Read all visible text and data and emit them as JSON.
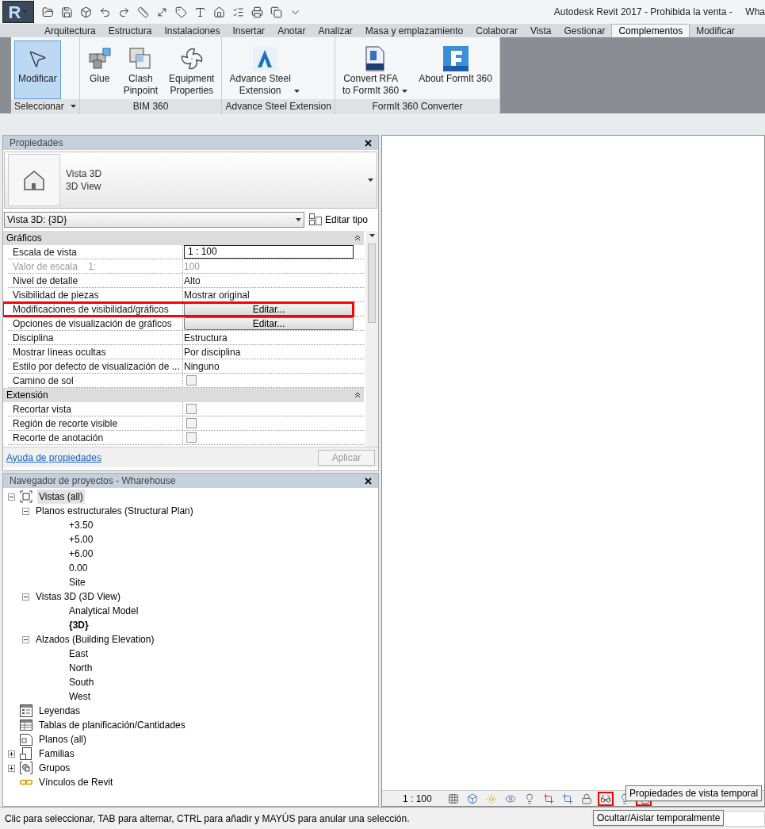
{
  "app_button": {
    "label": "R"
  },
  "window": {
    "title": "Autodesk Revit 2017 - Prohibida la venta -     Wha"
  },
  "ribbon_tabs": [
    {
      "label": "Arquitectura",
      "selected": false
    },
    {
      "label": "Estructura",
      "selected": false
    },
    {
      "label": "Instalaciones",
      "selected": false
    },
    {
      "label": "Insertar",
      "selected": false
    },
    {
      "label": "Anotar",
      "selected": false
    },
    {
      "label": "Analizar",
      "selected": false
    },
    {
      "label": "Masa y emplazamiento",
      "selected": false
    },
    {
      "label": "Colaborar",
      "selected": false
    },
    {
      "label": "Vista",
      "selected": false
    },
    {
      "label": "Gestionar",
      "selected": false
    },
    {
      "label": "Complementos",
      "selected": true
    },
    {
      "label": "Modificar",
      "selected": false
    }
  ],
  "ribbon_panels": [
    {
      "title": "Seleccionar",
      "title_menu": true,
      "buttons": [
        {
          "label_lines": [
            "Modificar"
          ],
          "selected": true,
          "dropdown": false
        }
      ]
    },
    {
      "title": "BIM 360",
      "title_menu": false,
      "buttons": [
        {
          "label_lines": [
            "Glue"
          ],
          "selected": false,
          "dropdown": false
        },
        {
          "label_lines": [
            "Clash",
            "Pinpoint"
          ],
          "selected": false,
          "dropdown": false
        },
        {
          "label_lines": [
            "Equipment",
            "Properties"
          ],
          "selected": false,
          "dropdown": false
        }
      ]
    },
    {
      "title": "Advance Steel Extension",
      "title_menu": false,
      "buttons": [
        {
          "label_lines": [
            "Advance Steel",
            "Extension"
          ],
          "selected": false,
          "dropdown": true
        }
      ]
    },
    {
      "title": "FormIt 360 Converter",
      "title_menu": false,
      "buttons": [
        {
          "label_lines": [
            "Convert RFA",
            "to FormIt 360"
          ],
          "selected": false,
          "dropdown": true
        },
        {
          "label_lines": [
            "About FormIt 360"
          ],
          "selected": false,
          "dropdown": false
        }
      ]
    }
  ],
  "properties": {
    "title": "Propiedades",
    "type_name": "Vista 3D",
    "type_subname": "3D View",
    "selector": "Vista 3D: {3D}",
    "edit_type": "Editar tipo",
    "groups": [
      {
        "title": "Gráficos",
        "rows": [
          {
            "kind": "field",
            "label": "Escala de vista",
            "value": "1 : 100",
            "disabled": false,
            "highlighted": false
          },
          {
            "kind": "value",
            "label": "Valor de escala    1:",
            "value": "100",
            "disabled": true,
            "highlighted": false
          },
          {
            "kind": "value",
            "label": "Nivel de detalle",
            "value": "Alto",
            "disabled": false,
            "highlighted": false
          },
          {
            "kind": "value",
            "label": "Visibilidad de piezas",
            "value": "Mostrar original",
            "disabled": false,
            "highlighted": false
          },
          {
            "kind": "button",
            "label": "Modificaciones de visibilidad/gráficos",
            "value": "Editar...",
            "disabled": false,
            "highlighted": true
          },
          {
            "kind": "button",
            "label": "Opciones de visualización de gráficos",
            "value": "Editar...",
            "disabled": false,
            "highlighted": false
          },
          {
            "kind": "value",
            "label": "Disciplina",
            "value": "Estructura",
            "disabled": false,
            "highlighted": false
          },
          {
            "kind": "value",
            "label": "Mostrar líneas ocultas",
            "value": "Por disciplina",
            "disabled": false,
            "highlighted": false
          },
          {
            "kind": "value",
            "label": "Estilo por defecto de visualización de ...",
            "value": "Ninguno",
            "disabled": false,
            "highlighted": false
          },
          {
            "kind": "checkbox",
            "label": "Camino de sol",
            "checked": false,
            "disabled": false,
            "highlighted": false
          }
        ]
      },
      {
        "title": "Extensión",
        "rows": [
          {
            "kind": "checkbox",
            "label": "Recortar vista",
            "checked": false,
            "disabled": false,
            "highlighted": false
          },
          {
            "kind": "checkbox",
            "label": "Región de recorte visible",
            "checked": false,
            "disabled": false,
            "highlighted": false
          },
          {
            "kind": "checkbox",
            "label": "Recorte de anotación",
            "checked": false,
            "disabled": false,
            "highlighted": false
          }
        ]
      }
    ],
    "help_link": "Ayuda de propiedades",
    "apply_button": {
      "label": "Aplicar",
      "disabled": true
    }
  },
  "project_browser": {
    "title": "Navegador de proyectos - Wharehouse",
    "tree": [
      {
        "label": "Vistas (all)",
        "expanded": true,
        "selected": true,
        "children": [
          {
            "label": "Planos estructurales (Structural Plan)",
            "expanded": true,
            "selected": false,
            "children": [
              {
                "label": "+3.50",
                "selected": false
              },
              {
                "label": "+5.00",
                "selected": false
              },
              {
                "label": "+6.00",
                "selected": false
              },
              {
                "label": "0.00",
                "selected": false
              },
              {
                "label": "Site",
                "selected": false
              }
            ]
          },
          {
            "label": "Vistas 3D (3D View)",
            "expanded": true,
            "selected": false,
            "children": [
              {
                "label": "Analytical Model",
                "selected": false,
                "current": false
              },
              {
                "label": "{3D}",
                "selected": false,
                "current": true
              }
            ]
          },
          {
            "label": "Alzados (Building Elevation)",
            "expanded": true,
            "selected": false,
            "children": [
              {
                "label": "East",
                "selected": false
              },
              {
                "label": "North",
                "selected": false
              },
              {
                "label": "South",
                "selected": false
              },
              {
                "label": "West",
                "selected": false
              }
            ]
          }
        ]
      },
      {
        "label": "Leyendas",
        "selected": false
      },
      {
        "label": "Tablas de planificación/Cantidades",
        "selected": false
      },
      {
        "label": "Planos (all)",
        "selected": false
      },
      {
        "label": "Familias",
        "expanded": false,
        "selected": false
      },
      {
        "label": "Grupos",
        "expanded": false,
        "selected": false
      },
      {
        "label": "Vínculos de Revit",
        "selected": false
      }
    ]
  },
  "view_bar": {
    "scale": "1 : 100",
    "tools": [
      {
        "highlighted": false
      },
      {
        "highlighted": false
      },
      {
        "highlighted": false
      },
      {
        "highlighted": false
      },
      {
        "highlighted": false
      },
      {
        "highlighted": false
      },
      {
        "highlighted": false
      },
      {
        "highlighted": false
      },
      {
        "highlighted": true
      },
      {
        "highlighted": false
      },
      {
        "highlighted": true
      }
    ]
  },
  "tooltips": [
    {
      "text": "Propiedades de vista temporal"
    },
    {
      "text": "Ocultar/Aislar temporalmente"
    }
  ],
  "status_bar": {
    "text": "Clic para seleccionar, TAB para alternar, CTRL para añadir y MAYÚS para anular una selección."
  }
}
